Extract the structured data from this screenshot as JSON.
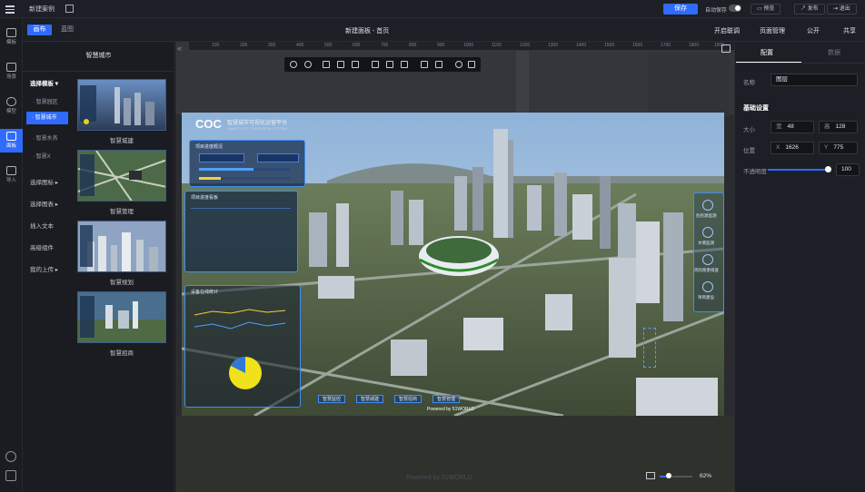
{
  "topbar": {
    "project_name": "新建案例",
    "save_label": "保存",
    "autosave_label": "自动保存",
    "preview_label": "预览",
    "publish_label": "发布",
    "exit_label": "退出"
  },
  "leftrail": {
    "items": [
      {
        "label": "模板"
      },
      {
        "label": "场景"
      },
      {
        "label": "模型"
      },
      {
        "label": "面板"
      },
      {
        "label": "导入"
      }
    ]
  },
  "secondbar": {
    "tab_canvas": "画布",
    "tab_blueprint": "蓝图",
    "doc_title": "新建面板 - 首页",
    "actions": [
      "开启联调",
      "页面管理",
      "公开",
      "共享"
    ]
  },
  "templates": {
    "panel_title": "智慧城市",
    "categories": [
      {
        "label": "选择模板",
        "bold": true
      },
      {
        "label": "选择图标"
      },
      {
        "label": "选择图表"
      },
      {
        "label": "插入文本"
      },
      {
        "label": "高级组件"
      },
      {
        "label": "我的上传"
      }
    ],
    "subcategories": [
      "智慧园区",
      "智慧城市",
      "智慧水务",
      "智慧X"
    ],
    "thumbs": [
      {
        "label": "智慧城建"
      },
      {
        "label": "智慧管理"
      },
      {
        "label": "智慧规划"
      },
      {
        "label": "智慧招商"
      }
    ]
  },
  "ruler": {
    "ticks": [
      "100",
      "200",
      "300",
      "400",
      "500",
      "600",
      "700",
      "800",
      "900",
      "1000",
      "1100",
      "1200",
      "1300",
      "1400",
      "1500",
      "1600",
      "1700",
      "1800",
      "1900"
    ]
  },
  "stage": {
    "brand": "COC",
    "title_cn": "智慧城市可视化运营平台",
    "title_en": "SMART CITY OPERATION SYSTEM",
    "panel1_title": "项目进度概况",
    "panel2_title": "项目进度看板",
    "panel3_title": "设备在线统计",
    "right_items": [
      "危险源监测",
      "水情监测",
      "风险隐患排查",
      "项目建设"
    ],
    "bottom_tabs": [
      "智慧监控",
      "智慧城建",
      "智慧招商",
      "智慧管理"
    ],
    "footer": "Powered by 51WORLD"
  },
  "zoom": {
    "value": "62%"
  },
  "props": {
    "tab_config": "配置",
    "tab_data": "数据",
    "name_label": "名称",
    "name_value": "图层",
    "section": "基础设置",
    "size_label": "大小",
    "w_prefix": "宽",
    "w_value": "48",
    "h_prefix": "高",
    "h_value": "128",
    "pos_label": "位置",
    "x_prefix": "X",
    "x_value": "1626",
    "y_prefix": "Y",
    "y_value": "775",
    "opacity_label": "不透明度",
    "opacity_value": "100"
  },
  "colors": {
    "accent": "#2f6bff",
    "panel_bg": "#1c1f25"
  }
}
